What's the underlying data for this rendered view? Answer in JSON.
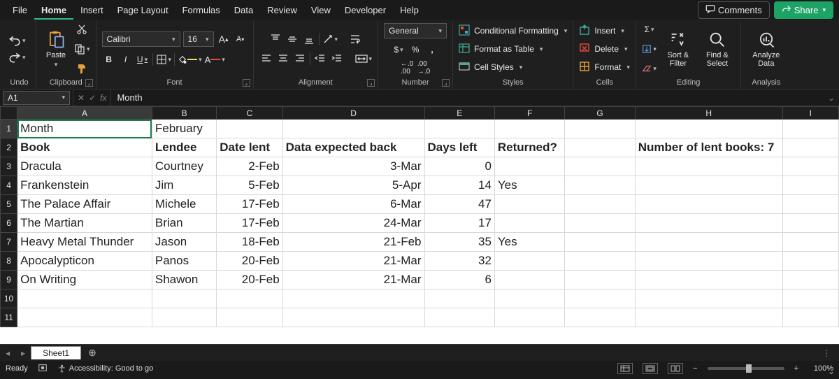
{
  "menu": {
    "tabs": [
      "File",
      "Home",
      "Insert",
      "Page Layout",
      "Formulas",
      "Data",
      "Review",
      "View",
      "Developer",
      "Help"
    ],
    "active": "Home",
    "comments": "Comments",
    "share": "Share"
  },
  "ribbon": {
    "undo": {
      "label": "Undo"
    },
    "clipboard": {
      "label": "Clipboard",
      "paste": "Paste"
    },
    "font": {
      "label": "Font",
      "name": "Calibri",
      "size": "16",
      "bold": "B",
      "italic": "I",
      "underline": "U"
    },
    "alignment": {
      "label": "Alignment"
    },
    "number": {
      "label": "Number",
      "format": "General",
      "currency": "$",
      "percent": "%",
      "comma": ","
    },
    "styles": {
      "label": "Styles",
      "cf": "Conditional Formatting",
      "fat": "Format as Table",
      "cs": "Cell Styles"
    },
    "cells": {
      "label": "Cells",
      "insert": "Insert",
      "delete": "Delete",
      "format": "Format"
    },
    "editing": {
      "label": "Editing",
      "sort": "Sort & Filter",
      "find": "Find & Select"
    },
    "analysis": {
      "label": "Analysis",
      "analyze": "Analyze Data"
    }
  },
  "formula": {
    "cellref": "A1",
    "value": "Month"
  },
  "columns": [
    "A",
    "B",
    "C",
    "D",
    "E",
    "F",
    "G",
    "H",
    "I"
  ],
  "rows": [
    {
      "n": "1",
      "c": [
        "Month",
        "February",
        "",
        "",
        "",
        "",
        "",
        "",
        ""
      ],
      "bold": [
        false,
        false,
        false,
        false,
        false,
        false,
        false,
        false,
        false
      ]
    },
    {
      "n": "2",
      "c": [
        "Book",
        "Lendee",
        "Date lent",
        "Data expected back",
        "Days left",
        "Returned?",
        "",
        "Number of lent books: 7",
        ""
      ],
      "bold": [
        true,
        true,
        true,
        true,
        true,
        true,
        false,
        true,
        false
      ]
    },
    {
      "n": "3",
      "c": [
        "Dracula",
        "Courtney",
        "2-Feb",
        "3-Mar",
        "0",
        "",
        "",
        "",
        ""
      ],
      "bold": [
        false,
        false,
        false,
        false,
        false,
        false,
        false,
        false,
        false
      ]
    },
    {
      "n": "4",
      "c": [
        "Frankenstein",
        "Jim",
        "5-Feb",
        "5-Apr",
        "14",
        "Yes",
        "",
        "",
        ""
      ],
      "bold": [
        false,
        false,
        false,
        false,
        false,
        false,
        false,
        false,
        false
      ]
    },
    {
      "n": "5",
      "c": [
        "The Palace Affair",
        "Michele",
        "17-Feb",
        "6-Mar",
        "47",
        "",
        "",
        "",
        ""
      ],
      "bold": [
        false,
        false,
        false,
        false,
        false,
        false,
        false,
        false,
        false
      ]
    },
    {
      "n": "6",
      "c": [
        "The Martian",
        "Brian",
        "17-Feb",
        "24-Mar",
        "17",
        "",
        "",
        "",
        ""
      ],
      "bold": [
        false,
        false,
        false,
        false,
        false,
        false,
        false,
        false,
        false
      ]
    },
    {
      "n": "7",
      "c": [
        "Heavy Metal Thunder",
        "Jason",
        "18-Feb",
        "21-Feb",
        "35",
        "Yes",
        "",
        "",
        ""
      ],
      "bold": [
        false,
        false,
        false,
        false,
        false,
        false,
        false,
        false,
        false
      ]
    },
    {
      "n": "8",
      "c": [
        "Apocalypticon",
        "Panos",
        "20-Feb",
        "21-Mar",
        "32",
        "",
        "",
        "",
        ""
      ],
      "bold": [
        false,
        false,
        false,
        false,
        false,
        false,
        false,
        false,
        false
      ]
    },
    {
      "n": "9",
      "c": [
        "On Writing",
        "Shawon",
        "20-Feb",
        "21-Mar",
        "6",
        "",
        "",
        "",
        ""
      ],
      "bold": [
        false,
        false,
        false,
        false,
        false,
        false,
        false,
        false,
        false
      ]
    },
    {
      "n": "10",
      "c": [
        "",
        "",
        "",
        "",
        "",
        "",
        "",
        "",
        ""
      ],
      "bold": [
        false,
        false,
        false,
        false,
        false,
        false,
        false,
        false,
        false
      ]
    },
    {
      "n": "11",
      "c": [
        "",
        "",
        "",
        "",
        "",
        "",
        "",
        "",
        ""
      ],
      "bold": [
        false,
        false,
        false,
        false,
        false,
        false,
        false,
        false,
        false
      ]
    }
  ],
  "rightAlignCols": [
    2,
    3,
    4
  ],
  "sheetTabs": {
    "active": "Sheet1"
  },
  "status": {
    "ready": "Ready",
    "accessibility": "Accessibility: Good to go",
    "zoom": "100%"
  }
}
